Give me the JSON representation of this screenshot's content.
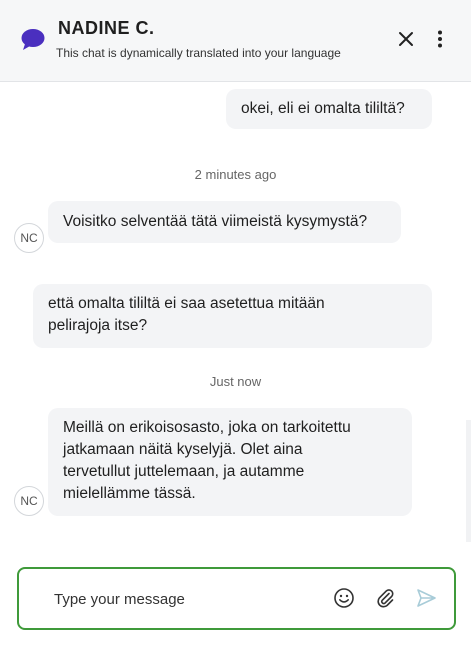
{
  "header": {
    "agent_name": "NADINE C.",
    "subtitle": "This chat is dynamically translated into your language",
    "brand_color": "#4a2fbf"
  },
  "messages": [
    {
      "side": "visitor",
      "text": "okei, eli ei omalta tililtä?"
    },
    {
      "type": "timestamp",
      "text": "2 minutes ago"
    },
    {
      "side": "agent",
      "avatar": "NC",
      "text": "Voisitko selventää tätä viimeistä kysymystä?"
    },
    {
      "side": "visitor",
      "text": "että omalta tililtä ei saa asetettua mitään\npelirajoja itse?"
    },
    {
      "type": "timestamp",
      "text": "Just now"
    },
    {
      "side": "agent",
      "avatar": "NC",
      "text": "Meillä on erikoisosasto, joka on tarkoitettu\njatkamaan näitä kyselyjä. Olet aina\ntervetullut juttelemaan, ja autamme\nmielellämme tässä."
    }
  ],
  "composer": {
    "placeholder": "Type your message",
    "value": "",
    "border_color": "#3f9a3a"
  },
  "icons": [
    "chat-bubble-icon",
    "close-icon",
    "more-vertical-icon",
    "emoji-icon",
    "attachment-icon",
    "send-icon"
  ]
}
